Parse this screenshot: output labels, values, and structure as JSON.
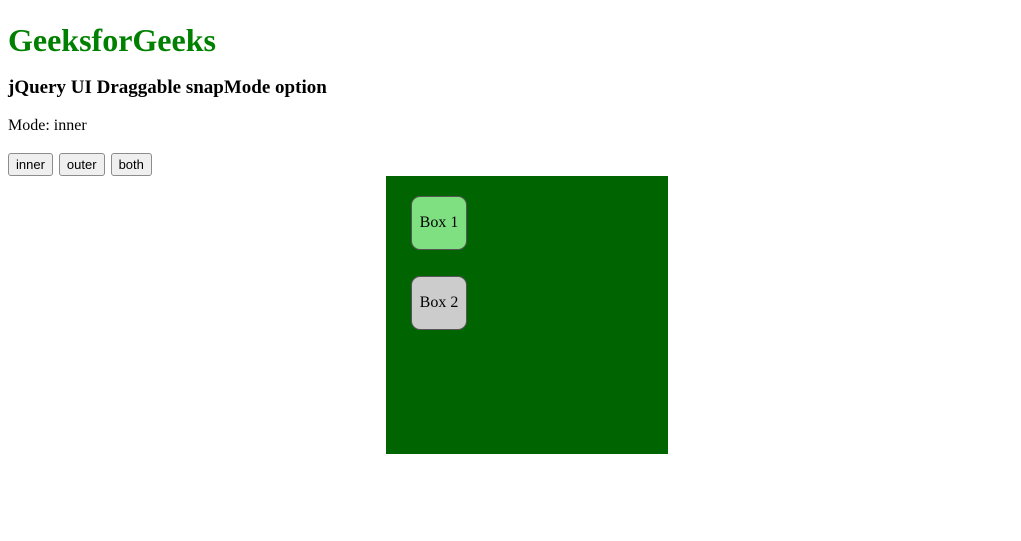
{
  "header": {
    "title": "GeeksforGeeks",
    "subtitle": "jQuery UI Draggable snapMode option"
  },
  "mode": {
    "label_prefix": "Mode: ",
    "current": "inner"
  },
  "buttons": {
    "inner": "inner",
    "outer": "outer",
    "both": "both"
  },
  "boxes": {
    "box1": "Box 1",
    "box2": "Box 2"
  }
}
